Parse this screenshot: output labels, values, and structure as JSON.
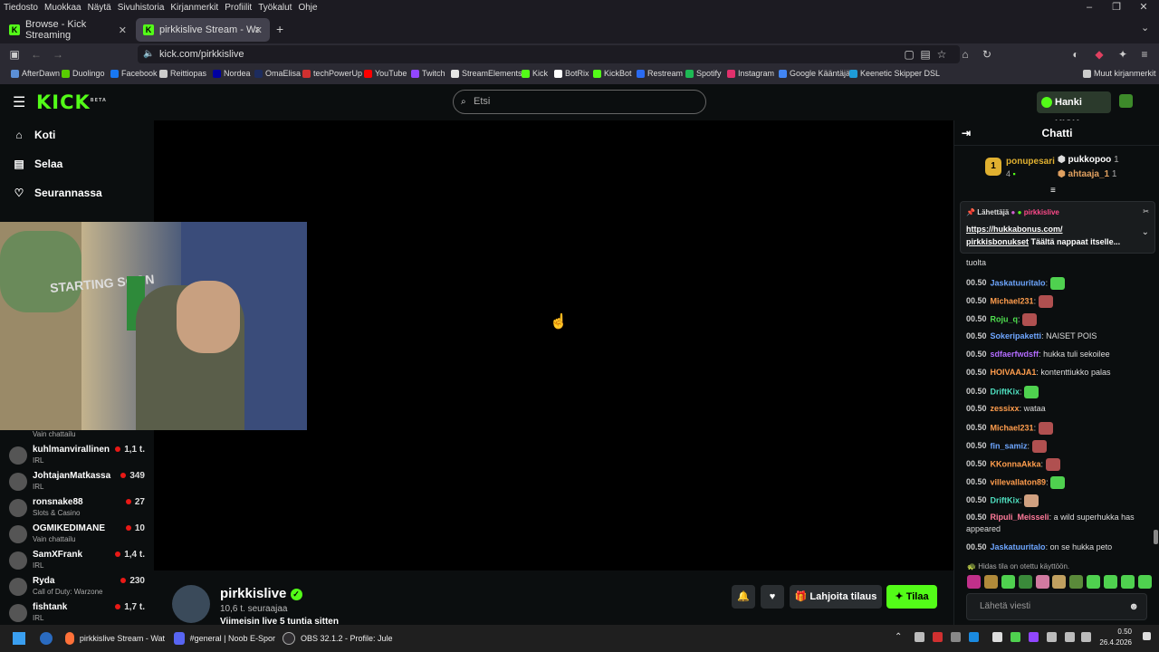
{
  "os_menu": [
    "Tiedosto",
    "Muokkaa",
    "Näytä",
    "Sivuhistoria",
    "Kirjanmerkit",
    "Profiilit",
    "Työkalut",
    "Ohje"
  ],
  "tabs": [
    {
      "label": "Browse - Kick Streaming"
    },
    {
      "label": "pirkkislive Stream - Watch l"
    }
  ],
  "url": "kick.com/pirkkislive",
  "bookmarks": [
    {
      "label": "AfterDawn",
      "color": "#5b8fd6"
    },
    {
      "label": "Duolingo",
      "color": "#58cc02"
    },
    {
      "label": "Facebook",
      "color": "#1877f2"
    },
    {
      "label": "Reittiopas",
      "color": "#cccccc"
    },
    {
      "label": "Nordea",
      "color": "#0000a0"
    },
    {
      "label": "OmaElisa",
      "color": "#1d2c5e"
    },
    {
      "label": "techPowerUp",
      "color": "#d03030"
    },
    {
      "label": "YouTube",
      "color": "#ff0000"
    },
    {
      "label": "Twitch",
      "color": "#9146ff"
    },
    {
      "label": "StreamElements",
      "color": "#e6e6e6"
    },
    {
      "label": "Kick",
      "color": "#53fc18"
    },
    {
      "label": "BotRix",
      "color": "#ffffff"
    },
    {
      "label": "KickBot",
      "color": "#53fc18"
    },
    {
      "label": "Restream",
      "color": "#2a6bf2"
    },
    {
      "label": "Spotify",
      "color": "#1db954"
    },
    {
      "label": "Instagram",
      "color": "#e1306c"
    },
    {
      "label": "Google Kääntäjä",
      "color": "#4285f4"
    },
    {
      "label": "Keenetic Skipper DSL",
      "color": "#1e9bd7"
    },
    {
      "label": "Muut kirjanmerkit",
      "color": "#cccccc"
    }
  ],
  "header": {
    "logo": "KICK",
    "logo_badge": "BETA",
    "search_placeholder": "Etsi",
    "kicks_button": "Hanki KICKs"
  },
  "sidebar": {
    "nav": [
      {
        "label": "Koti",
        "icon": "home-icon"
      },
      {
        "label": "Selaa",
        "icon": "browse-icon"
      },
      {
        "label": "Seurannassa",
        "icon": "heart-icon"
      }
    ],
    "partial_category": "Vain chattailu",
    "channels": [
      {
        "name": "kuhlmanvirallinen",
        "category": "IRL",
        "viewers": "1,1 t."
      },
      {
        "name": "JohtajanMatkassa",
        "category": "IRL",
        "viewers": "349"
      },
      {
        "name": "ronsnake88",
        "category": "Slots & Casino",
        "viewers": "27"
      },
      {
        "name": "OGMIKEDIMANE",
        "category": "Vain chattailu",
        "viewers": "10"
      },
      {
        "name": "SamXFrank",
        "category": "IRL",
        "viewers": "1,4 t."
      },
      {
        "name": "Ryda",
        "category": "Call of Duty: Warzone",
        "viewers": "230"
      },
      {
        "name": "fishtank",
        "category": "IRL",
        "viewers": "1,7 t."
      }
    ]
  },
  "webcam": {
    "overlay_text": "STARTING SOON"
  },
  "stream": {
    "name": "pirkkislive",
    "followers": "10,6 t. seuraajaa",
    "last_live": "Viimeisin live 5 tuntia sitten",
    "gift_button": "Lahjoita tilaus",
    "subscribe_button": "Tilaa"
  },
  "chat": {
    "title": "Chatti",
    "gifters": [
      {
        "rank": "1",
        "name": "ponupesari",
        "count": "4"
      },
      {
        "name": "pukkopoo",
        "count": "1"
      },
      {
        "name": "ahtaaja_1",
        "count": "1"
      }
    ],
    "pinned": {
      "label": "Lähettäjä",
      "sender": "pirkkislive",
      "link": "https://hukkabonus.com/",
      "text_bold": "pirkkisbonukset",
      "text": "Täältä nappaat itselle..."
    },
    "partial_message": "tuolta",
    "messages": [
      {
        "time": "00.50",
        "user": "Jaskatuuritalo",
        "color": "#6ea6ff",
        "text": "",
        "emote": "#4fd14f"
      },
      {
        "time": "00.50",
        "user": "Michael231",
        "color": "#ff9d4d",
        "text": "",
        "emote": "#b05050"
      },
      {
        "time": "00.50",
        "user": "Roju_q",
        "color": "#4fe04f",
        "text": "",
        "emote": "#b05050"
      },
      {
        "time": "00.50",
        "user": "Sokeripaketti",
        "color": "#6ea6ff",
        "text": "NAISET POIS",
        "emote": ""
      },
      {
        "time": "00.50",
        "user": "sdfaerfwdsff",
        "color": "#b36bff",
        "text": "hukka tuli sekoilee",
        "emote": ""
      },
      {
        "time": "00.50",
        "user": "HOIVAAJA1",
        "color": "#ff9d4d",
        "text": "kontenttiukko palas",
        "emote": ""
      },
      {
        "time": "00.50",
        "user": "DriftKix",
        "color": "#4fe0c0",
        "text": "",
        "emote": "#4fd14f"
      },
      {
        "time": "00.50",
        "user": "zessixx",
        "color": "#ff9d4d",
        "text": "wataa",
        "emote": ""
      },
      {
        "time": "00.50",
        "user": "Michael231",
        "color": "#ff9d4d",
        "text": "",
        "emote": "#b05050"
      },
      {
        "time": "00.50",
        "user": "fin_samiz",
        "color": "#6ea6ff",
        "text": "",
        "emote": "#b05050"
      },
      {
        "time": "00.50",
        "user": "KKonnaAkka",
        "color": "#ff9d4d",
        "text": "",
        "emote": "#b05050"
      },
      {
        "time": "00.50",
        "user": "villevallaton89",
        "color": "#ff9d4d",
        "text": "",
        "emote": "#4fd14f"
      },
      {
        "time": "00.50",
        "user": "DriftKix",
        "color": "#4fe0c0",
        "text": "",
        "emote": "#d0a080"
      },
      {
        "time": "00.50",
        "user": "Ripuli_Meisseli",
        "color": "#ff7a9a",
        "text": "a wild superhukka has",
        "text2": "appeared",
        "emote": ""
      },
      {
        "time": "00.50",
        "user": "Jaskatuuritalo",
        "color": "#6ea6ff",
        "text": "on se hukka peto",
        "emote": ""
      }
    ],
    "slow_mode": "Hidas tila on otettu käyttöön.",
    "input_placeholder": "Lähetä viesti"
  },
  "taskbar": {
    "items": [
      {
        "label": "pirkkislive Stream - Wat",
        "icon": "firefox-icon",
        "color": "#ff7139"
      },
      {
        "label": "#general | Noob E-Spor",
        "icon": "discord-icon",
        "color": "#5865f2"
      },
      {
        "label": "OBS 32.1.2 - Profile: Jule",
        "icon": "obs-icon",
        "color": "#302e31"
      }
    ],
    "time": "0.50",
    "date": "26.4.2026"
  }
}
